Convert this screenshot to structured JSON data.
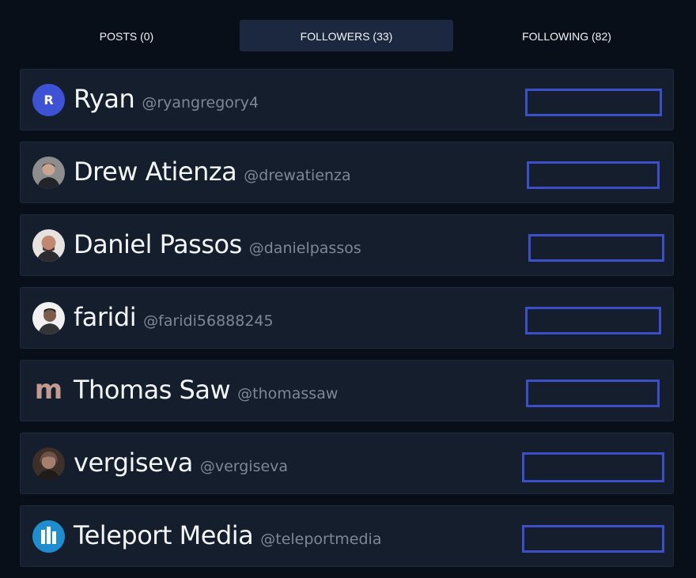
{
  "tabs": [
    {
      "label": "POSTS (0)"
    },
    {
      "label": "FOLLOWERS (33)"
    },
    {
      "label": "FOLLOWING (82)"
    }
  ],
  "active_tab": "FOLLOWERS (33)",
  "followers": [
    {
      "name": "Ryan",
      "handle": "@ryangregory4",
      "avatar_monogram": "R",
      "avatar_icon": "monogram-avatar",
      "follow_button_label": ""
    },
    {
      "name": "Drew Atienza",
      "handle": "@drewatienza",
      "avatar_icon": "user-photo-avatar",
      "follow_button_label": ""
    },
    {
      "name": "Daniel Passos",
      "handle": "@danielpassos",
      "avatar_icon": "user-photo-avatar",
      "follow_button_label": ""
    },
    {
      "name": "faridi",
      "handle": "@faridi56888245",
      "avatar_icon": "user-photo-avatar",
      "follow_button_label": ""
    },
    {
      "name": "Thomas Saw",
      "handle": "@thomassaw",
      "avatar_monogram": "m",
      "avatar_icon": "m-logo-avatar",
      "follow_button_label": ""
    },
    {
      "name": "vergiseva",
      "handle": "@vergiseva",
      "avatar_icon": "user-photo-avatar",
      "follow_button_label": ""
    },
    {
      "name": "Teleport Media",
      "handle": "@teleportmedia",
      "avatar_icon": "teleport-logo-avatar",
      "follow_button_label": ""
    }
  ],
  "colors": {
    "background": "#090f19",
    "card": "#141e2d",
    "active_tab": "#1c2840",
    "button_border": "#3d4ec9",
    "handle_text": "#7d8796",
    "monogram_bg": "#3d52d5",
    "m_logo": "#c39a8f"
  }
}
